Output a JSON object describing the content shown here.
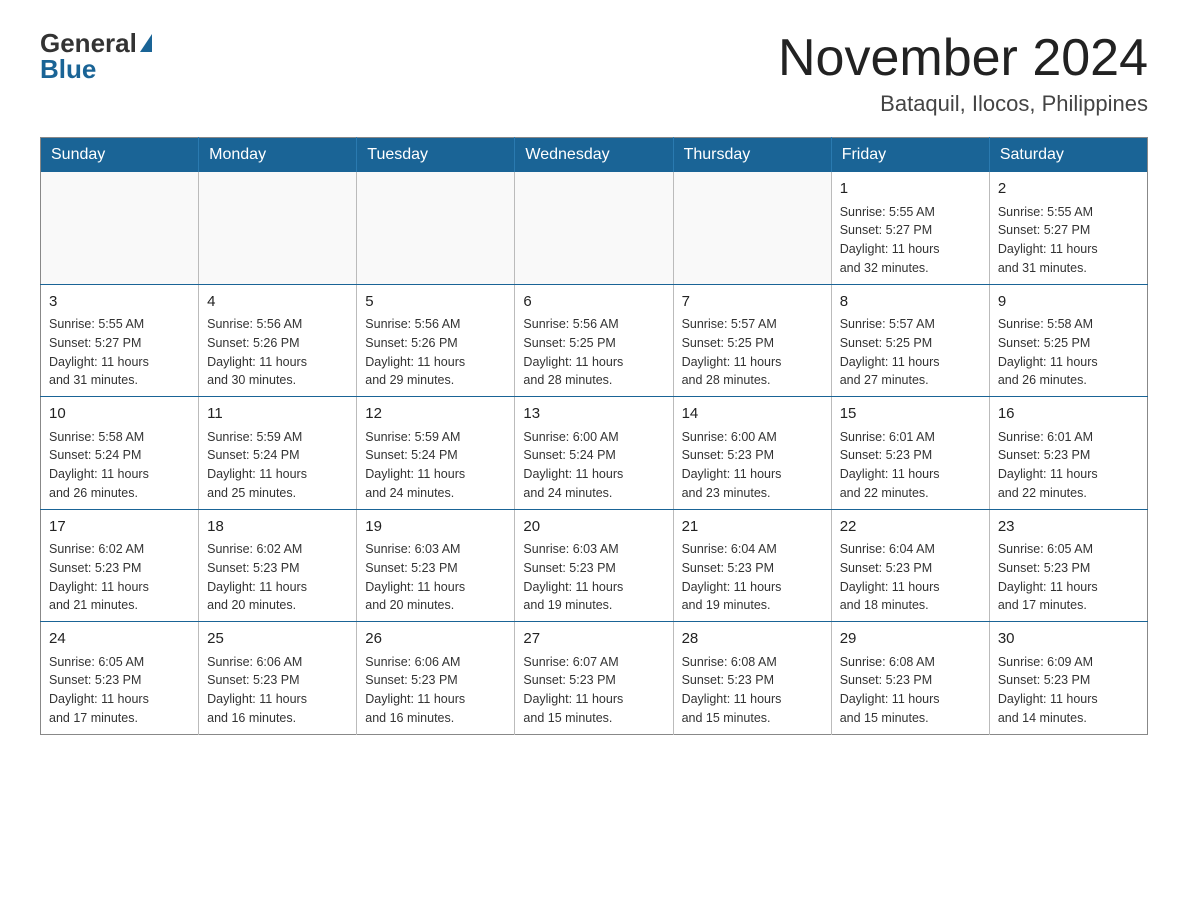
{
  "header": {
    "logo_general": "General",
    "logo_blue": "Blue",
    "page_title": "November 2024",
    "subtitle": "Bataquil, Ilocos, Philippines"
  },
  "calendar": {
    "days_of_week": [
      "Sunday",
      "Monday",
      "Tuesday",
      "Wednesday",
      "Thursday",
      "Friday",
      "Saturday"
    ],
    "weeks": [
      [
        {
          "day": "",
          "info": ""
        },
        {
          "day": "",
          "info": ""
        },
        {
          "day": "",
          "info": ""
        },
        {
          "day": "",
          "info": ""
        },
        {
          "day": "",
          "info": ""
        },
        {
          "day": "1",
          "info": "Sunrise: 5:55 AM\nSunset: 5:27 PM\nDaylight: 11 hours\nand 32 minutes."
        },
        {
          "day": "2",
          "info": "Sunrise: 5:55 AM\nSunset: 5:27 PM\nDaylight: 11 hours\nand 31 minutes."
        }
      ],
      [
        {
          "day": "3",
          "info": "Sunrise: 5:55 AM\nSunset: 5:27 PM\nDaylight: 11 hours\nand 31 minutes."
        },
        {
          "day": "4",
          "info": "Sunrise: 5:56 AM\nSunset: 5:26 PM\nDaylight: 11 hours\nand 30 minutes."
        },
        {
          "day": "5",
          "info": "Sunrise: 5:56 AM\nSunset: 5:26 PM\nDaylight: 11 hours\nand 29 minutes."
        },
        {
          "day": "6",
          "info": "Sunrise: 5:56 AM\nSunset: 5:25 PM\nDaylight: 11 hours\nand 28 minutes."
        },
        {
          "day": "7",
          "info": "Sunrise: 5:57 AM\nSunset: 5:25 PM\nDaylight: 11 hours\nand 28 minutes."
        },
        {
          "day": "8",
          "info": "Sunrise: 5:57 AM\nSunset: 5:25 PM\nDaylight: 11 hours\nand 27 minutes."
        },
        {
          "day": "9",
          "info": "Sunrise: 5:58 AM\nSunset: 5:25 PM\nDaylight: 11 hours\nand 26 minutes."
        }
      ],
      [
        {
          "day": "10",
          "info": "Sunrise: 5:58 AM\nSunset: 5:24 PM\nDaylight: 11 hours\nand 26 minutes."
        },
        {
          "day": "11",
          "info": "Sunrise: 5:59 AM\nSunset: 5:24 PM\nDaylight: 11 hours\nand 25 minutes."
        },
        {
          "day": "12",
          "info": "Sunrise: 5:59 AM\nSunset: 5:24 PM\nDaylight: 11 hours\nand 24 minutes."
        },
        {
          "day": "13",
          "info": "Sunrise: 6:00 AM\nSunset: 5:24 PM\nDaylight: 11 hours\nand 24 minutes."
        },
        {
          "day": "14",
          "info": "Sunrise: 6:00 AM\nSunset: 5:23 PM\nDaylight: 11 hours\nand 23 minutes."
        },
        {
          "day": "15",
          "info": "Sunrise: 6:01 AM\nSunset: 5:23 PM\nDaylight: 11 hours\nand 22 minutes."
        },
        {
          "day": "16",
          "info": "Sunrise: 6:01 AM\nSunset: 5:23 PM\nDaylight: 11 hours\nand 22 minutes."
        }
      ],
      [
        {
          "day": "17",
          "info": "Sunrise: 6:02 AM\nSunset: 5:23 PM\nDaylight: 11 hours\nand 21 minutes."
        },
        {
          "day": "18",
          "info": "Sunrise: 6:02 AM\nSunset: 5:23 PM\nDaylight: 11 hours\nand 20 minutes."
        },
        {
          "day": "19",
          "info": "Sunrise: 6:03 AM\nSunset: 5:23 PM\nDaylight: 11 hours\nand 20 minutes."
        },
        {
          "day": "20",
          "info": "Sunrise: 6:03 AM\nSunset: 5:23 PM\nDaylight: 11 hours\nand 19 minutes."
        },
        {
          "day": "21",
          "info": "Sunrise: 6:04 AM\nSunset: 5:23 PM\nDaylight: 11 hours\nand 19 minutes."
        },
        {
          "day": "22",
          "info": "Sunrise: 6:04 AM\nSunset: 5:23 PM\nDaylight: 11 hours\nand 18 minutes."
        },
        {
          "day": "23",
          "info": "Sunrise: 6:05 AM\nSunset: 5:23 PM\nDaylight: 11 hours\nand 17 minutes."
        }
      ],
      [
        {
          "day": "24",
          "info": "Sunrise: 6:05 AM\nSunset: 5:23 PM\nDaylight: 11 hours\nand 17 minutes."
        },
        {
          "day": "25",
          "info": "Sunrise: 6:06 AM\nSunset: 5:23 PM\nDaylight: 11 hours\nand 16 minutes."
        },
        {
          "day": "26",
          "info": "Sunrise: 6:06 AM\nSunset: 5:23 PM\nDaylight: 11 hours\nand 16 minutes."
        },
        {
          "day": "27",
          "info": "Sunrise: 6:07 AM\nSunset: 5:23 PM\nDaylight: 11 hours\nand 15 minutes."
        },
        {
          "day": "28",
          "info": "Sunrise: 6:08 AM\nSunset: 5:23 PM\nDaylight: 11 hours\nand 15 minutes."
        },
        {
          "day": "29",
          "info": "Sunrise: 6:08 AM\nSunset: 5:23 PM\nDaylight: 11 hours\nand 15 minutes."
        },
        {
          "day": "30",
          "info": "Sunrise: 6:09 AM\nSunset: 5:23 PM\nDaylight: 11 hours\nand 14 minutes."
        }
      ]
    ]
  }
}
